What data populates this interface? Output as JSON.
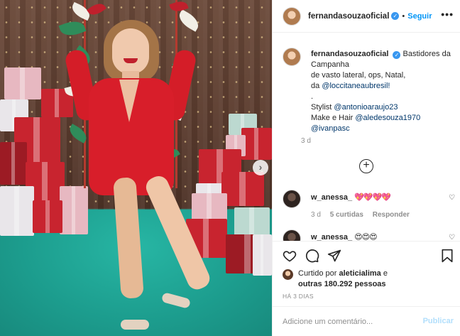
{
  "post": {
    "author": "fernandasouzaoficial",
    "verified_mark": "✓",
    "follow_label": "Seguir",
    "more_options_icon": "more-horizontal-icon",
    "caption": {
      "line1": "Bastidores da Campanha",
      "line2": "de vasto lateral, ops, Natal,",
      "line3_prefix": "da",
      "mention_loccitane": "@loccitaneaubresil!",
      "line4": ".",
      "stylist_label": "Stylist",
      "mention_stylist": "@antonioaraujo23",
      "makeup_label": "Make e Hair",
      "mention_makeup": "@aledesouza1970",
      "mention_ivan": "@ivanpasc",
      "age": "3 d"
    },
    "load_more_icon": "plus-circle-icon",
    "comments": [
      {
        "username": "w_anessa_",
        "emoji": "💖💖💖💖",
        "age": "3 d",
        "likes": "5 curtidas",
        "reply_label": "Responder"
      },
      {
        "username": "w_anessa_",
        "emoji": "😍😍😍",
        "age": "",
        "likes": "",
        "reply_label": ""
      }
    ],
    "liked_by": {
      "prefix": "Curtido por",
      "user": "aleticialima",
      "connector": "e",
      "others": "outras 180.292 pessoas"
    },
    "timestamp": "HÁ 3 DIAS",
    "comment_input": {
      "placeholder": "Adicione um comentário...",
      "value": ""
    },
    "publish_label": "Publicar",
    "carousel_next": "›"
  },
  "colors": {
    "link": "#00376b",
    "follow": "#0095f6",
    "publish_disabled": "#b2dffc",
    "dress": "#d81e2a",
    "floor": "#1fa898"
  }
}
